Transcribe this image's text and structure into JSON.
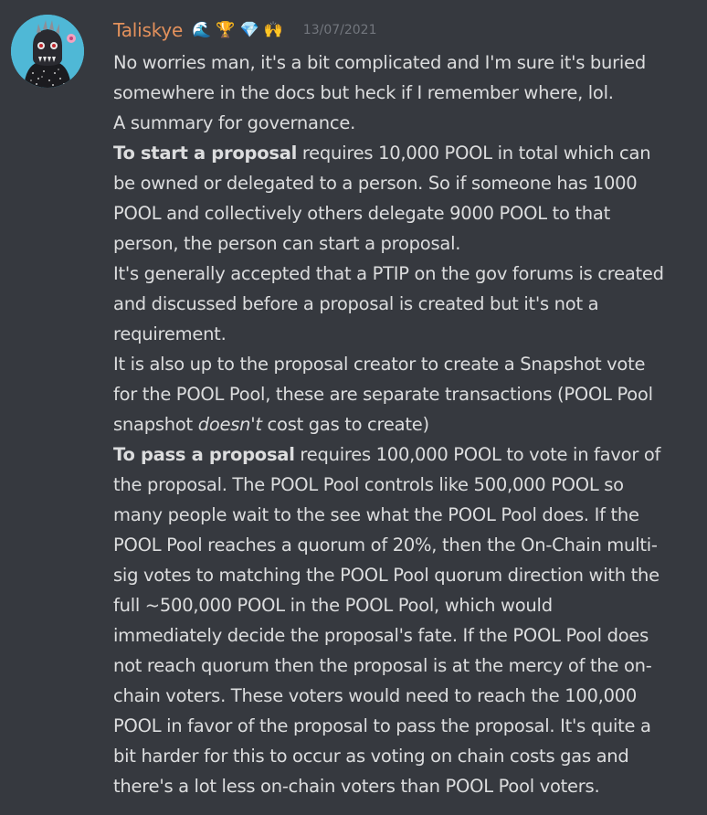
{
  "message": {
    "username": "Taliskye",
    "badges": {
      "wave": "🌊",
      "trophy": "🏆",
      "gem": "💎",
      "hands": "🙌"
    },
    "timestamp": "13/07/2021",
    "username_color": "#e3915c",
    "lines": {
      "l1": "No worries man, it's a bit complicated and I'm sure it's buried",
      "l2": "somewhere in the docs but heck if I remember where, lol.",
      "l3": "A summary for governance.",
      "l4_bold": "To start a proposal",
      "l4_rest": " requires 10,000 POOL in total which can",
      "l5": "be owned or delegated to a person. So if someone has 1000",
      "l6": "POOL and collectively others delegate 9000 POOL to that",
      "l7": "person, the person can start a proposal.",
      "l8": "It's generally accepted that a PTIP on the gov forums is created",
      "l9": "and discussed before a proposal is created but it's not a",
      "l10": "requirement.",
      "l11": "It is also up to the proposal creator to create a Snapshot vote",
      "l12": "for the POOL Pool, these are separate transactions (POOL Pool",
      "l13_pre": "snapshot ",
      "l13_em": "doesn't",
      "l13_post": " cost gas to create)",
      "l14_bold": "To pass a proposal",
      "l14_rest": " requires 100,000 POOL to vote in favor of",
      "l15": "the proposal. The POOL Pool controls like 500,000 POOL so",
      "l16": "many people wait to the see what the POOL Pool does. If the",
      "l17": "POOL Pool reaches a quorum of 20%, then the On-Chain multi-",
      "l18": "sig votes to matching the POOL Pool quorum direction with the",
      "l19": "full ~500,000 POOL in the POOL Pool, which would",
      "l20": "immediately decide the proposal's fate. If the POOL Pool does",
      "l21": "not reach quorum then the proposal is at the mercy of the on-",
      "l22": "chain voters. These voters would need to reach the 100,000",
      "l23": "POOL in favor of the proposal to pass the proposal. It's quite a",
      "l24": "bit harder for this to occur as voting on chain costs gas and",
      "l25": "there's a lot less on-chain voters than POOL Pool voters."
    }
  }
}
